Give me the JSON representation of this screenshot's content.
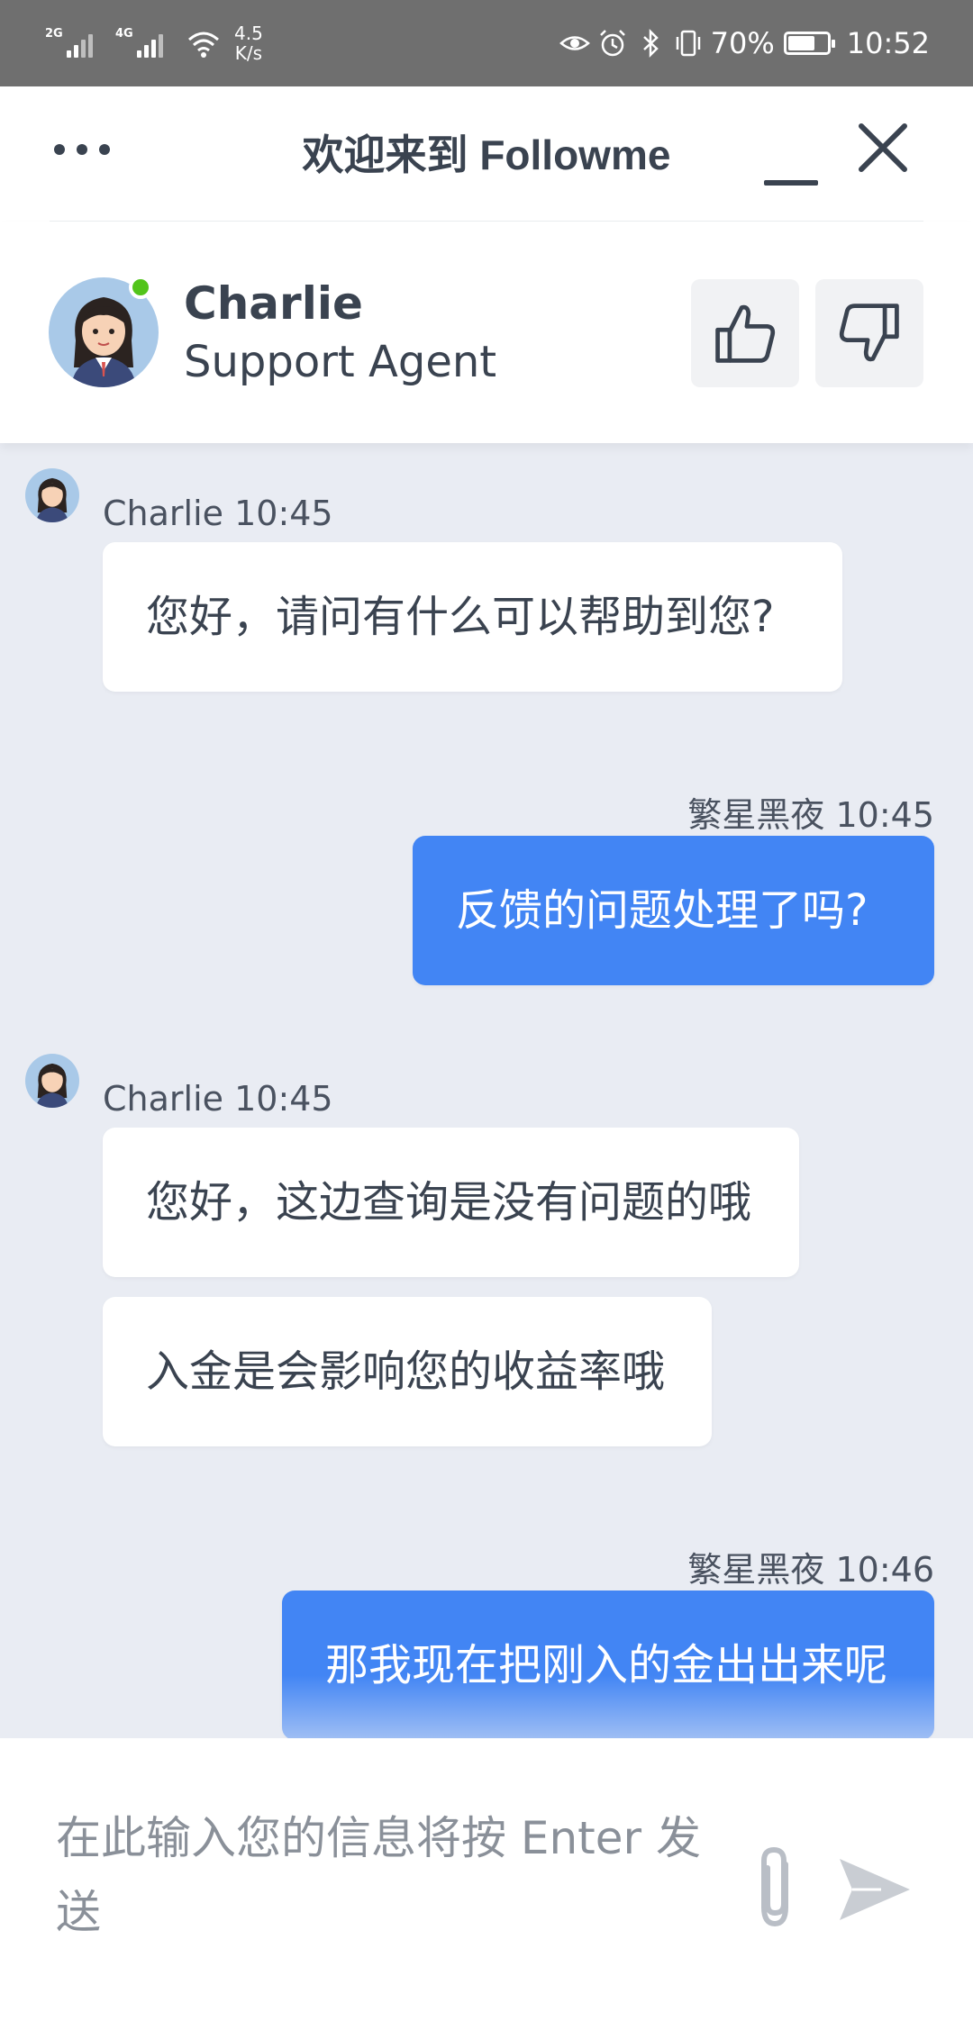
{
  "status_bar": {
    "signal_1": "2G",
    "signal_2": "4G",
    "net_speed_value": "4.5",
    "net_speed_unit": "K/s",
    "battery_percent": "70%",
    "battery_level": 0.7,
    "time": "10:52"
  },
  "header": {
    "title": "欢迎来到 Followme"
  },
  "agent": {
    "name": "Charlie",
    "role": "Support Agent",
    "online_color": "#52c41a"
  },
  "messages": [
    {
      "sender": "Charlie 10:45",
      "text": "您好，请问有什么可以帮助到您?",
      "from": "agent"
    },
    {
      "sender": "繁星黑夜 10:45",
      "text": "反馈的问题处理了吗?",
      "from": "user"
    },
    {
      "sender": "Charlie 10:45",
      "text": "您好，这边查询是没有问题的哦",
      "from": "agent"
    },
    {
      "text": "入金是会影响您的收益率哦",
      "from": "agent"
    },
    {
      "sender": "繁星黑夜 10:46",
      "text": "那我现在把刚入的金出出来呢",
      "from": "user"
    }
  ],
  "composer": {
    "placeholder": "在此输入您的信息将按 Enter 发送"
  },
  "icons": {
    "more": "more-dots-icon",
    "minimize": "minimize-icon",
    "close": "close-icon",
    "thumbs_up": "thumbs-up-icon",
    "thumbs_down": "thumbs-down-icon",
    "attach": "paperclip-icon",
    "send": "send-icon"
  },
  "colors": {
    "user_bubble": "#4285f4",
    "chat_background": "#e9ecf3",
    "status_bar": "#6f6f6f"
  }
}
